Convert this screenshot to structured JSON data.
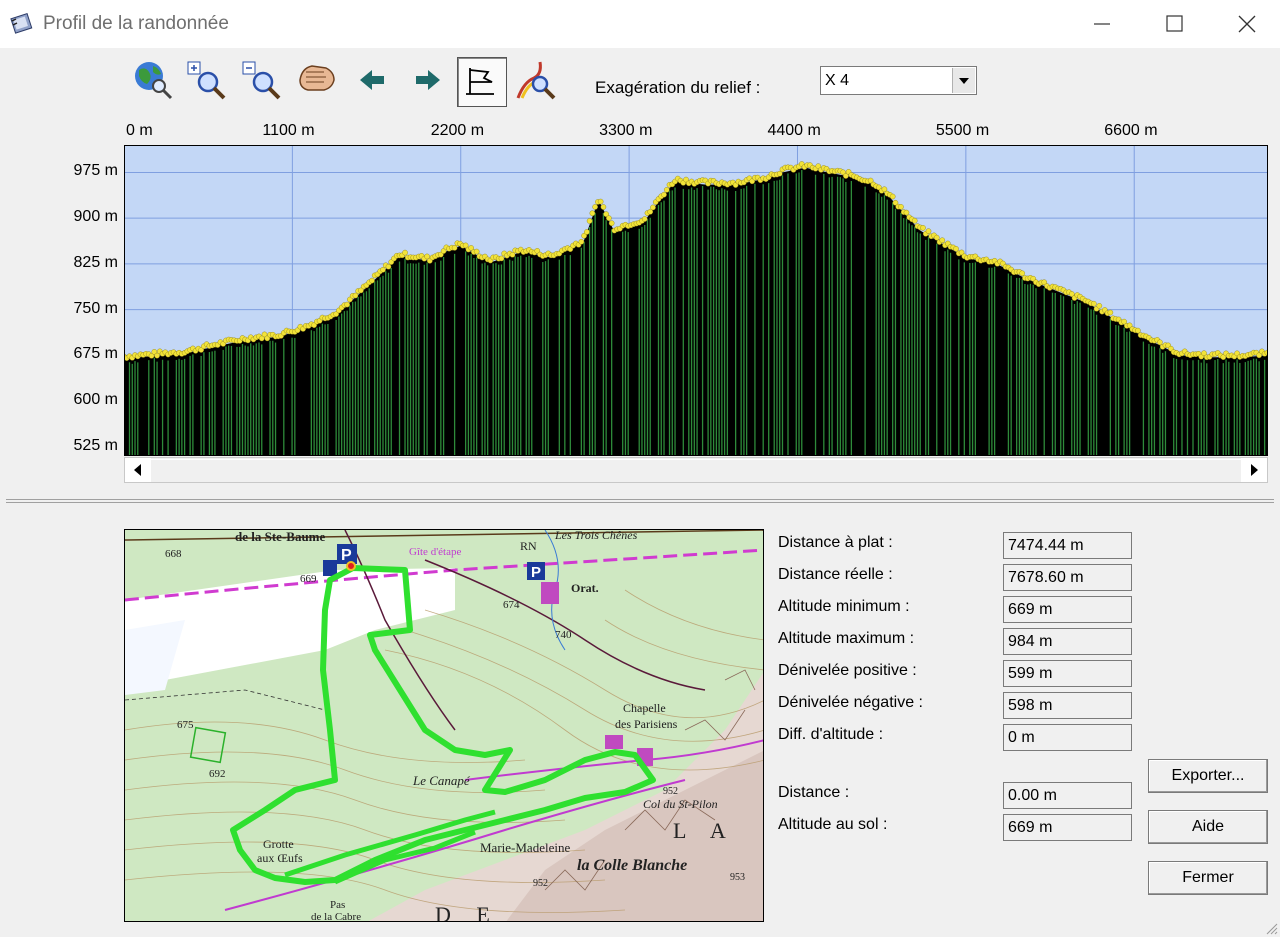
{
  "window": {
    "title": "Profil de la randonnée",
    "icon": "notebook-icon",
    "controls": [
      "minimize-icon",
      "maximize-icon",
      "close-icon"
    ]
  },
  "toolbar": {
    "buttons": [
      {
        "name": "globe-zoom-icon"
      },
      {
        "name": "zoom-in-icon"
      },
      {
        "name": "zoom-out-icon"
      },
      {
        "name": "hand-pan-icon"
      },
      {
        "name": "arrow-left-icon"
      },
      {
        "name": "arrow-right-icon"
      },
      {
        "name": "flag-profile-icon",
        "active": true
      },
      {
        "name": "route-zoom-icon"
      }
    ],
    "relief_label": "Exagération du relief :",
    "relief_value": "X 4"
  },
  "chart_data": {
    "type": "area",
    "x_ticks": [
      "0 m",
      "1100 m",
      "2200 m",
      "3300 m",
      "4400 m",
      "5500 m",
      "6600 m"
    ],
    "y_ticks": [
      "975 m",
      "900 m",
      "825 m",
      "750 m",
      "675 m",
      "600 m",
      "525 m"
    ],
    "xlim": [
      0,
      7474
    ],
    "ylim": [
      510,
      1020
    ],
    "grid": true,
    "colors": {
      "sky": "#c3d7f6",
      "terrain": "#000000",
      "bars": "#2e8b3a",
      "points": "#f2e33a",
      "grid": "#7f9fe0"
    },
    "profile": {
      "x": [
        0,
        200,
        400,
        600,
        800,
        1000,
        1200,
        1400,
        1600,
        1800,
        2000,
        2100,
        2200,
        2300,
        2400,
        2600,
        2800,
        2900,
        3000,
        3100,
        3200,
        3400,
        3500,
        3600,
        3800,
        4000,
        4200,
        4300,
        4450,
        4600,
        4750,
        4900,
        5000,
        5200,
        5400,
        5500,
        5700,
        5900,
        6100,
        6300,
        6500,
        6700,
        6900,
        7100,
        7300,
        7474
      ],
      "y": [
        670,
        674,
        678,
        690,
        700,
        705,
        720,
        745,
        790,
        838,
        830,
        845,
        855,
        840,
        828,
        845,
        835,
        848,
        860,
        930,
        880,
        895,
        930,
        960,
        955,
        955,
        965,
        975,
        983,
        975,
        968,
        955,
        935,
        880,
        850,
        835,
        825,
        800,
        780,
        760,
        730,
        700,
        675,
        672,
        672,
        675
      ]
    }
  },
  "stats": [
    {
      "label": "Distance à plat :",
      "value": "7474.44 m"
    },
    {
      "label": "Distance réelle :",
      "value": "7678.60 m"
    },
    {
      "label": "Altitude minimum :",
      "value": "669 m"
    },
    {
      "label": "Altitude maximum :",
      "value": "984 m"
    },
    {
      "label": "Dénivelée positive :",
      "value": "599 m"
    },
    {
      "label": "Dénivelée négative :",
      "value": "598 m"
    },
    {
      "label": "Diff. d'altitude :",
      "value": "0 m"
    }
  ],
  "cursor_stats": [
    {
      "label": "Distance :",
      "value": "0.00 m"
    },
    {
      "label": "Altitude au sol :",
      "value": "669 m"
    }
  ],
  "buttons": {
    "export": "Exporter...",
    "help": "Aide",
    "close": "Fermer"
  },
  "map": {
    "labels": [
      {
        "text": "de la Ste-Baume"
      },
      {
        "text": "Gîte d'étape"
      },
      {
        "text": "Les Trois Chênes"
      },
      {
        "text": "RN"
      },
      {
        "text": "Orat."
      },
      {
        "text": "668"
      },
      {
        "text": "669"
      },
      {
        "text": "674"
      },
      {
        "text": "740"
      },
      {
        "text": "675"
      },
      {
        "text": "692"
      },
      {
        "text": "Chapelle"
      },
      {
        "text": "des Parisiens"
      },
      {
        "text": "Le Canapé"
      },
      {
        "text": "Col du St-Pilon"
      },
      {
        "text": "Grotte"
      },
      {
        "text": "aux Œufs"
      },
      {
        "text": "Marie-Madeleine"
      },
      {
        "text": "la Colle Blanche"
      },
      {
        "text": "Pas"
      },
      {
        "text": "de la Cabre"
      },
      {
        "text": "952"
      },
      {
        "text": "953"
      },
      {
        "text": "952"
      },
      {
        "text": "L A"
      },
      {
        "text": "D E"
      }
    ]
  }
}
